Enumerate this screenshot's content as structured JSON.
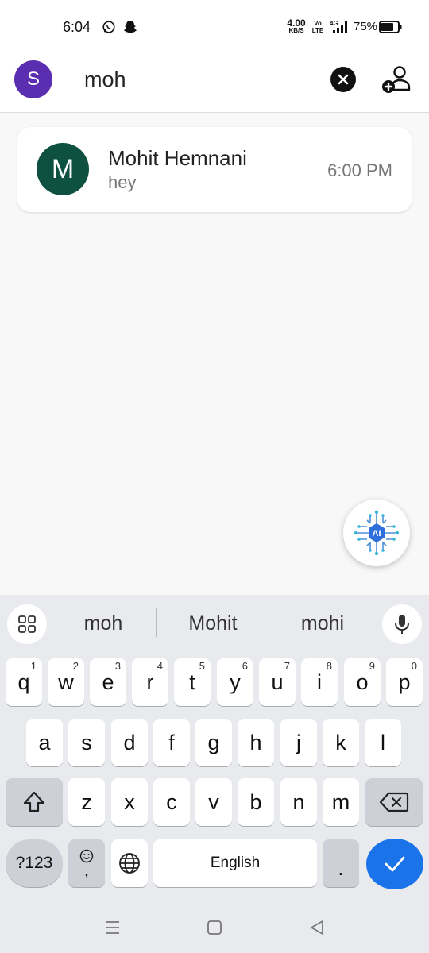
{
  "status_bar": {
    "time": "6:04",
    "net_speed_value": "4.00",
    "net_speed_unit": "KB/S",
    "volte_top": "Vo",
    "volte_bottom": "LTE",
    "network": "4G",
    "battery_percent": "75%",
    "icons": [
      "whatsapp-icon",
      "snapchat-icon",
      "signal-icon",
      "battery-icon"
    ]
  },
  "header": {
    "avatar_initial": "S",
    "search_value": "moh",
    "icons": [
      "clear-search-icon",
      "add-contact-icon"
    ]
  },
  "results": [
    {
      "avatar_initial": "M",
      "name": "Mohit Hemnani",
      "last_message": "hey",
      "time": "6:00 PM"
    }
  ],
  "fab": {
    "label": "AI",
    "icon": "ai-chip-icon"
  },
  "keyboard": {
    "suggestions": [
      "moh",
      "Mohit",
      "mohi"
    ],
    "row1": [
      {
        "key": "q",
        "hint": "1"
      },
      {
        "key": "w",
        "hint": "2"
      },
      {
        "key": "e",
        "hint": "3"
      },
      {
        "key": "r",
        "hint": "4"
      },
      {
        "key": "t",
        "hint": "5"
      },
      {
        "key": "y",
        "hint": "6"
      },
      {
        "key": "u",
        "hint": "7"
      },
      {
        "key": "i",
        "hint": "8"
      },
      {
        "key": "o",
        "hint": "9"
      },
      {
        "key": "p",
        "hint": "0"
      }
    ],
    "row2": [
      "a",
      "s",
      "d",
      "f",
      "g",
      "h",
      "j",
      "k",
      "l"
    ],
    "row3": [
      "z",
      "x",
      "c",
      "v",
      "b",
      "n",
      "m"
    ],
    "symbols_label": "?123",
    "comma": ",",
    "space_label": "English",
    "period": ".",
    "colors": {
      "accent": "#1a73e8",
      "background": "#e8eaee"
    }
  },
  "colors": {
    "user_avatar": "#5b2db0",
    "contact_avatar": "#0e5140"
  }
}
